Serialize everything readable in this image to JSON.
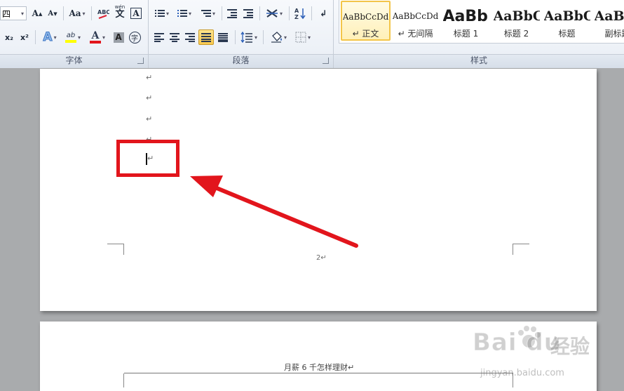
{
  "ribbon": {
    "font": {
      "size_value": "四",
      "label": "字体",
      "grow_label": "A",
      "shrink_label": "A",
      "case_label": "Aa",
      "phonetic_label": "文",
      "phonetic_top": "wén",
      "border_char_label": "A",
      "subscript_label": "x₂",
      "superscript_label": "x²",
      "effects_label": "A",
      "highlight_label": "ab",
      "color_label": "A",
      "shading_label": "A",
      "enclose_label": "字"
    },
    "paragraph": {
      "label": "段落"
    },
    "styles": {
      "label": "样式",
      "tiles": [
        {
          "sample": "AaBbCcDd",
          "name": "↵ 正文"
        },
        {
          "sample": "AaBbCcDd",
          "name": "↵ 无间隔"
        },
        {
          "sample": "AaBb",
          "name": "标题 1"
        },
        {
          "sample": "AaBbC",
          "name": "标题 2"
        },
        {
          "sample": "AaBbC",
          "name": "标题"
        },
        {
          "sample": "AaBl",
          "name": "副标题"
        }
      ]
    }
  },
  "document": {
    "page1": {
      "para_mark": "↵",
      "page_number": "2↵"
    },
    "page2": {
      "header_text": "月薪 6 千怎样理财↵"
    }
  },
  "colors": {
    "highlight_box": "#e2151c",
    "arrow": "#e2151c",
    "selected_style": "#f3c54a"
  },
  "watermark": {
    "brand": "Bai du",
    "brand_cn": "经验",
    "url": "jingyan.baidu.com"
  }
}
